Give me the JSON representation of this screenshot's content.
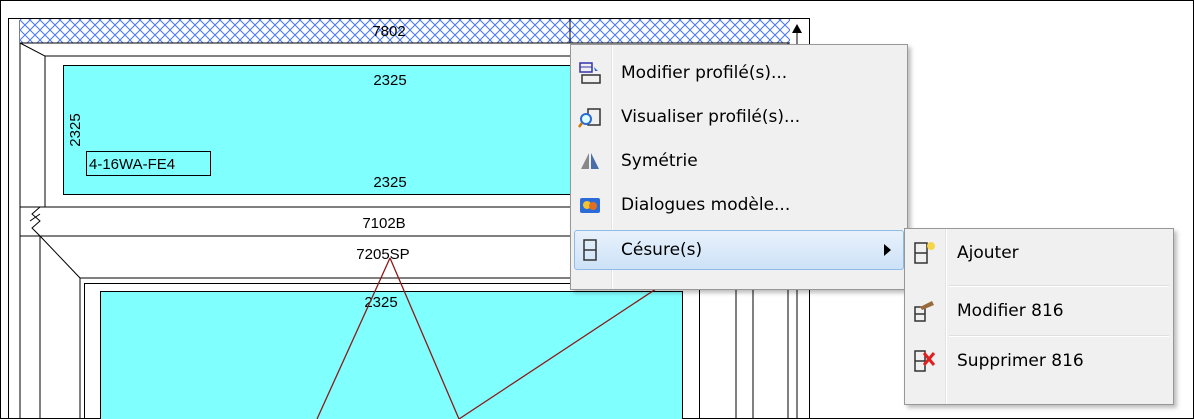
{
  "drawing": {
    "labels": {
      "top_profile": "7802",
      "glass_top_width": "2325",
      "glass_side_height": "2325",
      "glass_type": "4-16WA-FE4",
      "glass_bottom_width": "2325",
      "transom_profile": "7102B",
      "sash_profile": "7205SP",
      "glass_lower_width": "2325"
    },
    "colors": {
      "glass": "#80ffff",
      "hatch": "#4477ff",
      "opening_lines": "#8b1a1a"
    }
  },
  "context_menu": {
    "items": [
      {
        "label": "Modifier profilé(s)...",
        "icon": "edit-profile-icon"
      },
      {
        "label": "Visualiser profilé(s)...",
        "icon": "view-profile-icon"
      },
      {
        "label": "Symétrie",
        "icon": "symmetry-icon"
      },
      {
        "label": "Dialogues modèle...",
        "icon": "model-dialog-icon"
      },
      {
        "label": "Césure(s)",
        "icon": "split-icon",
        "has_submenu": true,
        "highlighted": true
      }
    ]
  },
  "submenu": {
    "items": [
      {
        "label": "Ajouter",
        "icon": "split-add-icon"
      },
      {
        "label": "Modifier 816",
        "icon": "split-edit-icon"
      },
      {
        "label": "Supprimer 816",
        "icon": "split-delete-icon"
      }
    ]
  }
}
